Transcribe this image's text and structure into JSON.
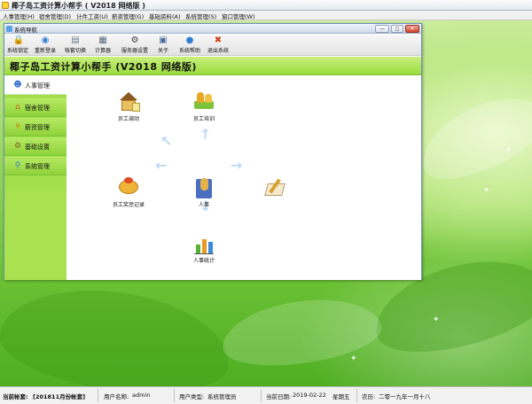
{
  "app": {
    "title": "椰子岛工资计算小帮手 ( V2018 网络版 )"
  },
  "menu": [
    "人事管理(H)",
    "宿舍管理(D)",
    "计件工资(U)",
    "薪资管理(G)",
    "基础资料(A)",
    "系统管理(S)",
    "窗口管理(W)"
  ],
  "nav_window": {
    "title": "系统导航"
  },
  "toolbar": [
    {
      "label": "系统锁定",
      "icon": "lock-icon"
    },
    {
      "label": "重新登录",
      "icon": "globe-icon"
    },
    {
      "label": "帐套切换",
      "icon": "switch-icon"
    },
    {
      "label": "计算器",
      "icon": "calculator-icon"
    },
    {
      "label": "服务器设置",
      "icon": "server-gear-icon"
    },
    {
      "label": "关于",
      "icon": "about-icon"
    },
    {
      "label": "系统帮助",
      "icon": "help-icon"
    },
    {
      "label": "退出系统",
      "icon": "exit-icon"
    }
  ],
  "banner": {
    "title": "椰子岛工资计算小帮手 (V2018 网络版)"
  },
  "sidebar": [
    {
      "label": "人事管理",
      "icon": "people-icon",
      "active": true
    },
    {
      "label": "宿舍管理",
      "icon": "house-icon"
    },
    {
      "label": "薪资管理",
      "icon": "money-icon"
    },
    {
      "label": "基础设置",
      "icon": "settings-icon"
    },
    {
      "label": "系统管理",
      "icon": "key-icon"
    }
  ],
  "content": {
    "nodes": {
      "transfer": "员工调动",
      "training": "员工培训",
      "reward": "员工奖惩记录",
      "center": "人事",
      "stats": "人事统计"
    }
  },
  "status_bar": {
    "account_label": "当前帐套:",
    "account_value": "[201811月份帐套]",
    "user_label": "用户名称:",
    "user_value": "admin",
    "type_label": "用户类型:",
    "type_value": "系统管理员",
    "date_label": "当前日期:",
    "date_value": "2019-02-22",
    "weekday": "星期五",
    "lunar_label": "农历:",
    "lunar_value": "二零一九年一月十八"
  },
  "colors": {
    "accent_green": "#9adb3e",
    "sidebar_green": "#a3df4a",
    "arrow_blue": "#bfd9f4"
  }
}
